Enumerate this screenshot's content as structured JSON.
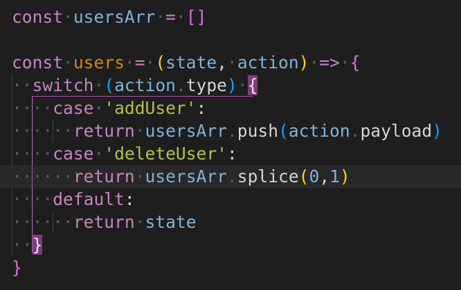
{
  "editor": {
    "lines": [
      {
        "tokens": [
          {
            "t": "const",
            "c": "kw"
          },
          {
            "t": "·",
            "c": "ws"
          },
          {
            "t": "usersArr",
            "c": "param2"
          },
          {
            "t": "·",
            "c": "ws"
          },
          {
            "t": "=",
            "c": "op"
          },
          {
            "t": "·",
            "c": "ws"
          },
          {
            "t": "[]",
            "c": "bracket-pink"
          }
        ]
      },
      {
        "tokens": []
      },
      {
        "tokens": [
          {
            "t": "const",
            "c": "kw"
          },
          {
            "t": "·",
            "c": "ws"
          },
          {
            "t": "users",
            "c": "fn-name"
          },
          {
            "t": "·",
            "c": "ws"
          },
          {
            "t": "=",
            "c": "op"
          },
          {
            "t": "·",
            "c": "ws"
          },
          {
            "t": "(",
            "c": "bracket-gold"
          },
          {
            "t": "state",
            "c": "param2"
          },
          {
            "t": ",",
            "c": "punc"
          },
          {
            "t": "·",
            "c": "ws"
          },
          {
            "t": "action",
            "c": "param2"
          },
          {
            "t": ")",
            "c": "bracket-gold"
          },
          {
            "t": "·",
            "c": "ws"
          },
          {
            "t": "=>",
            "c": "op"
          },
          {
            "t": "·",
            "c": "ws"
          },
          {
            "t": "{",
            "c": "bracket-pink"
          }
        ]
      },
      {
        "tokens": [
          {
            "t": "··",
            "c": "ws"
          },
          {
            "t": "switch",
            "c": "ctrl"
          },
          {
            "t": "·",
            "c": "ws"
          },
          {
            "t": "(",
            "c": "bracket-blue"
          },
          {
            "t": "action",
            "c": "param2"
          },
          {
            "t": ".",
            "c": "ws"
          },
          {
            "t": "type",
            "c": "prop"
          },
          {
            "t": ")",
            "c": "bracket-blue"
          },
          {
            "t": "·",
            "c": "ws"
          },
          {
            "t": "{",
            "c": "brace-match"
          }
        ]
      },
      {
        "tokens": [
          {
            "t": "····",
            "c": "ws"
          },
          {
            "t": "case",
            "c": "ctrl"
          },
          {
            "t": "·",
            "c": "ws"
          },
          {
            "t": "'addUser'",
            "c": "str2"
          },
          {
            "t": ":",
            "c": "punc"
          }
        ]
      },
      {
        "tokens": [
          {
            "t": "······",
            "c": "ws"
          },
          {
            "t": "return",
            "c": "ctrl"
          },
          {
            "t": "·",
            "c": "ws"
          },
          {
            "t": "usersArr",
            "c": "param2"
          },
          {
            "t": ".",
            "c": "ws"
          },
          {
            "t": "push",
            "c": "prop"
          },
          {
            "t": "(",
            "c": "bracket-blue"
          },
          {
            "t": "action",
            "c": "param2"
          },
          {
            "t": ".",
            "c": "ws"
          },
          {
            "t": "payload",
            "c": "prop"
          },
          {
            "t": ")",
            "c": "bracket-blue"
          }
        ]
      },
      {
        "tokens": [
          {
            "t": "····",
            "c": "ws"
          },
          {
            "t": "case",
            "c": "ctrl"
          },
          {
            "t": "·",
            "c": "ws"
          },
          {
            "t": "'deleteUser'",
            "c": "str2"
          },
          {
            "t": ":",
            "c": "punc"
          }
        ]
      },
      {
        "current": true,
        "tokens": [
          {
            "t": "······",
            "c": "ws"
          },
          {
            "t": "return",
            "c": "ctrl"
          },
          {
            "t": "·",
            "c": "ws"
          },
          {
            "t": "usersArr",
            "c": "param2"
          },
          {
            "t": ".",
            "c": "ws"
          },
          {
            "t": "splice",
            "c": "prop"
          },
          {
            "t": "(",
            "c": "bracket-gold"
          },
          {
            "t": "0",
            "c": "num2"
          },
          {
            "t": ",",
            "c": "punc"
          },
          {
            "t": "1",
            "c": "num2"
          },
          {
            "t": ")",
            "c": "bracket-gold"
          }
        ]
      },
      {
        "tokens": [
          {
            "t": "····",
            "c": "ws"
          },
          {
            "t": "default",
            "c": "ctrl"
          },
          {
            "t": ":",
            "c": "punc"
          }
        ]
      },
      {
        "tokens": [
          {
            "t": "······",
            "c": "ws"
          },
          {
            "t": "return",
            "c": "ctrl"
          },
          {
            "t": "·",
            "c": "ws"
          },
          {
            "t": "state",
            "c": "param2"
          }
        ]
      },
      {
        "tokens": [
          {
            "t": "··",
            "c": "ws"
          },
          {
            "t": "}",
            "c": "brace-match"
          }
        ]
      },
      {
        "tokens": [
          {
            "t": "}",
            "c": "bracket-pink"
          }
        ]
      }
    ]
  }
}
